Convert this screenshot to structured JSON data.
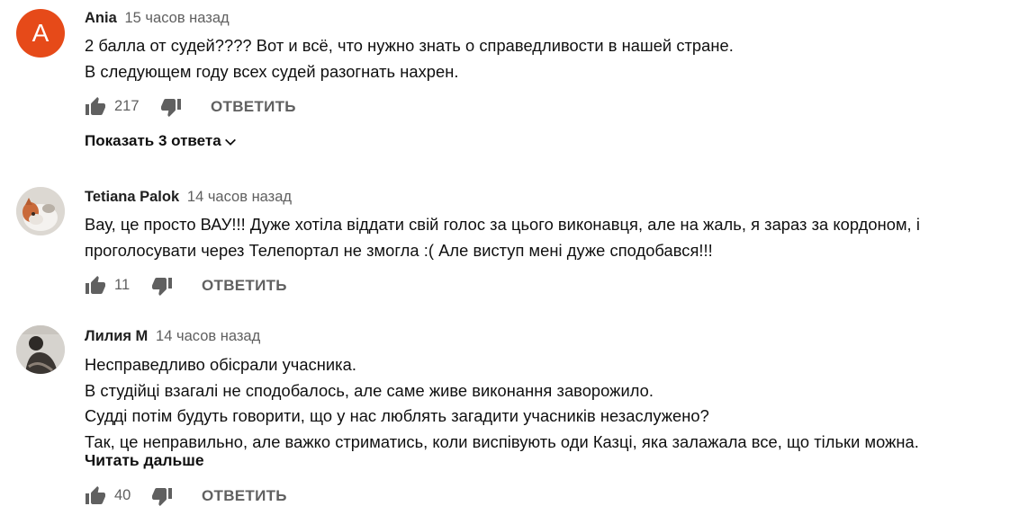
{
  "comments": [
    {
      "author": "Ania",
      "time": "15 часов назад",
      "avatar_letter": "A",
      "avatar_color": "#e64a19",
      "lines": [
        "2 балла от судей????  Вот и всё,  что нужно знать о справедливости в нашей стране.",
        "В следующем году всех судей разогнать нахрен."
      ],
      "likes": "217",
      "reply_label": "ОТВЕТИТЬ",
      "replies_label": "Показать 3 ответа"
    },
    {
      "author": "Tetiana Palok",
      "time": "14 часов назад",
      "avatar_icon": "cat-photo-avatar",
      "lines": [
        "Вау, це просто ВАУ!!! Дуже хотіла віддати свій голос за цього виконавця, але на жаль, я зараз за кордоном, і",
        "проголосувати через Телепортал не змогла :( Але виступ мені дуже сподобався!!!"
      ],
      "likes": "11",
      "reply_label": "ОТВЕТИТЬ"
    },
    {
      "author": "Лилия М",
      "time": "14 часов назад",
      "avatar_icon": "person-photo-avatar",
      "lines": [
        "Несправедливо обісрали учасника.",
        "В студійці взагалі не сподобалось, але саме живе виконання заворожило.",
        "Судді потім будуть говорити, що у нас люблять загадити учасників незаслужено?",
        "Так, це неправильно, але важко стриматись, коли виспівують оди Казці, яка залажала все, що тільки можна."
      ],
      "read_more": "Читать дальше",
      "likes": "40",
      "reply_label": "ОТВЕТИТЬ"
    }
  ]
}
